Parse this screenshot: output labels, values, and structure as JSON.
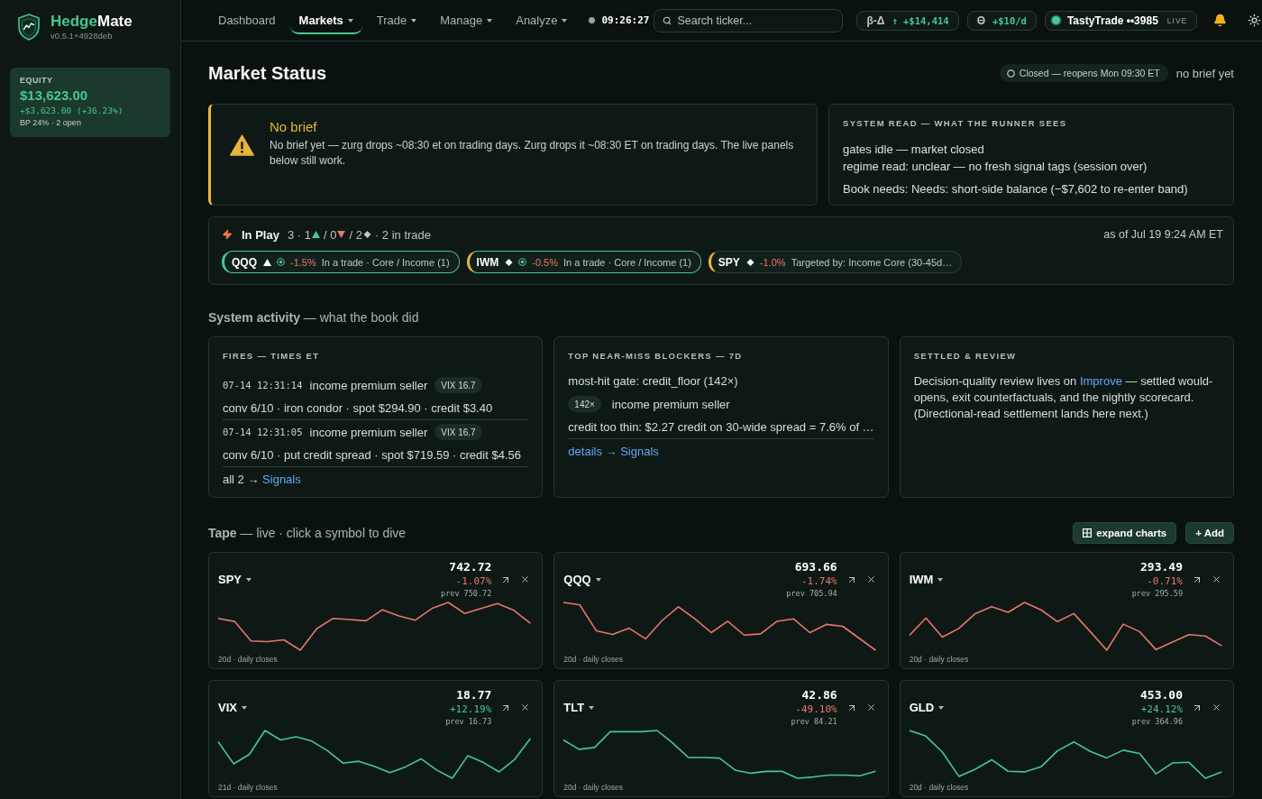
{
  "sidebar": {
    "brand": {
      "name": [
        "Hedge",
        "Mate"
      ],
      "version": "v0.5.1+4928deb"
    },
    "equity": {
      "label": "EQUITY",
      "value": "$13,623.00",
      "change": "+$3,623.00 (+36.23%)",
      "detail": "BP 24% · 2 open"
    }
  },
  "top_nav": {
    "items": [
      {
        "label": "Dashboard",
        "selected": false,
        "has_menu": false
      },
      {
        "label": "Markets",
        "selected": true,
        "has_menu": true
      },
      {
        "label": "Trade",
        "selected": false,
        "has_menu": true
      },
      {
        "label": "Manage",
        "selected": false,
        "has_menu": true
      },
      {
        "label": "Analyze",
        "selected": false,
        "has_menu": true
      }
    ],
    "clock": {
      "time": "09:26:27",
      "live": false
    },
    "search": {
      "placeholder": "Search ticker..."
    },
    "stats": [
      {
        "label": "β-Δ",
        "value": "↑ +$14,414"
      },
      {
        "label": "Θ",
        "value": "+$10/d"
      }
    ],
    "broker": {
      "name": "TastyTrade ••3985",
      "mode": "LIVE",
      "connected": true
    }
  },
  "header": {
    "title": "Market Status",
    "market_state": {
      "label": "Closed — reopens Mon 09:30 ET",
      "open": false
    },
    "brief_status": "no brief yet"
  },
  "brief": {
    "kind": "warning",
    "title": "No brief",
    "body": "No brief yet — zurg drops ~08:30 et on trading days. Zurg drops it ~08:30 ET on trading days. The live panels below still work."
  },
  "system_read": {
    "heading": "SYSTEM READ — WHAT THE RUNNER SEES",
    "lines": [
      "gates idle — market closed",
      "regime read: unclear — no fresh signal tags (session over)"
    ],
    "book_needs": "Book needs: Needs: short-side balance (−$7,602 to re-enter band)"
  },
  "in_play": {
    "title": "In Play",
    "summary": [
      {
        "kind": "up",
        "text": "3 · 1"
      },
      {
        "kind": "down",
        "text": "/ 0"
      },
      {
        "kind": "flat",
        "text": "/ 2"
      },
      {
        "kind": "plain",
        "text": "· 2 in trade"
      }
    ],
    "as_of": "as of Jul 19 9:24 AM ET",
    "chips": [
      {
        "kind": "up",
        "symbol": "QQQ",
        "in_trade": true,
        "falling": true,
        "change": "-1.5%",
        "note": "In a trade · Core / Income (1)"
      },
      {
        "kind": "flat",
        "symbol": "IWM",
        "in_trade": true,
        "falling": true,
        "change": "-0.5%",
        "note": "In a trade · Core / Income (1)"
      },
      {
        "kind": "flat",
        "symbol": "SPY",
        "in_trade": false,
        "falling": true,
        "change": "-1.0%",
        "note": "Targeted by: Income Core (30-45d…"
      }
    ]
  },
  "activity": {
    "title": "**System activity** — what the book did",
    "cards": [
      {
        "kind": "fires",
        "heading": "FIRES — TIMES ET",
        "entries": [
          {
            "time": "07-14 12:31:14",
            "strategy": "income premium seller",
            "tag": "VIX 16.7",
            "detail": "conv 6/10 · iron condor · spot $294.90 · credit $3.40"
          },
          {
            "time": "07-14 12:31:05",
            "strategy": "income premium seller",
            "tag": "VIX 16.7",
            "detail": "conv 6/10 · put credit spread · spot $719.59 · credit $4.56"
          }
        ],
        "footer": {
          "text": "all 2 →",
          "link": "Signals"
        }
      },
      {
        "kind": "blockers",
        "heading": "TOP NEAR-MISS BLOCKERS — 7D",
        "top_gate": "most-hit gate: credit_floor (142×)",
        "count_tag": "142×",
        "strategy": "income premium seller",
        "reason": "credit too thin: $2.27 credit on 30-wide spread = 7.6% of …",
        "link": "details → Signals"
      },
      {
        "kind": "review",
        "heading": "SETTLED & REVIEW",
        "before": "Decision-quality review lives on",
        "link": "Improve",
        "after": "— settled would-opens, exit counterfactuals, and the nightly scorecard. (Directional-read settlement lands here next.)"
      }
    ]
  },
  "tape": {
    "title": "**Tape** — live · click a symbol to dive",
    "actions": [
      {
        "kind": "expand",
        "label": "expand charts"
      },
      {
        "kind": "add",
        "label": "+ Add"
      }
    ],
    "cards": [
      {
        "symbol": "SPY",
        "price": "742.72",
        "change": "-1.07%",
        "falling": true,
        "prev": "prev 750.72",
        "color": "#e9756a",
        "caption": "20d · daily closes"
      },
      {
        "symbol": "QQQ",
        "price": "693.66",
        "change": "-1.74%",
        "falling": true,
        "prev": "prev 705.94",
        "color": "#e9756a",
        "caption": "20d · daily closes"
      },
      {
        "symbol": "IWM",
        "price": "293.49",
        "change": "-0.71%",
        "falling": true,
        "prev": "prev 295.59",
        "color": "#e9756a",
        "caption": "20d · daily closes"
      },
      {
        "symbol": "VIX",
        "price": "18.77",
        "change": "+12.19%",
        "falling": false,
        "prev": "prev 16.73",
        "color": "#45c98e",
        "caption": "21d · daily closes"
      },
      {
        "symbol": "TLT",
        "price": "42.86",
        "change": "-49.10%",
        "falling": true,
        "prev": "prev 84.21",
        "color": "#45c98e",
        "caption": "20d · daily closes"
      },
      {
        "symbol": "GLD",
        "price": "453.00",
        "change": "+24.12%",
        "falling": false,
        "prev": "prev 364.96",
        "color": "#45c98e",
        "caption": "20d · daily closes"
      }
    ]
  }
}
